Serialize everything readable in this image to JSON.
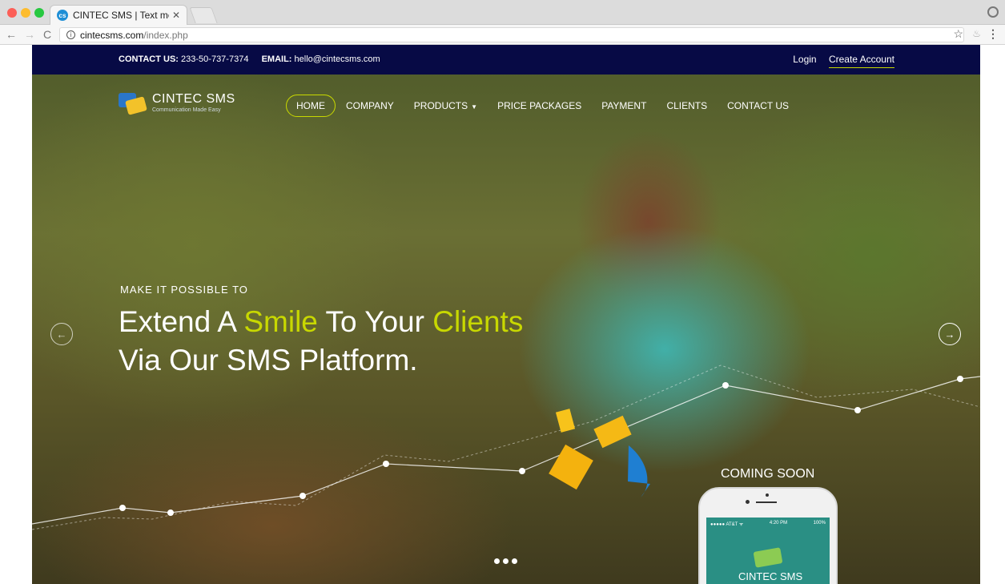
{
  "browser": {
    "tab_title": "CINTEC SMS | Text messaging",
    "favicon_text": "cs",
    "url_host": "cintecsms.com",
    "url_path": "/index.php"
  },
  "topbar": {
    "contact_label": "CONTACT US:",
    "contact_phone": "233-50-737-7374",
    "email_label": "EMAIL:",
    "email_value": "hello@cintecsms.com",
    "login": "Login",
    "create_account": "Create Account"
  },
  "logo": {
    "name": "CINTEC SMS",
    "tagline": "Communication Made Easy"
  },
  "nav": {
    "items": [
      {
        "label": "HOME"
      },
      {
        "label": "COMPANY"
      },
      {
        "label": "PRODUCTS"
      },
      {
        "label": "PRICE PACKAGES"
      },
      {
        "label": "PAYMENT"
      },
      {
        "label": "CLIENTS"
      },
      {
        "label": "CONTACT US"
      }
    ]
  },
  "hero": {
    "eyebrow": "MAKE IT POSSIBLE TO",
    "line1_a": "Extend A ",
    "line1_b": "Smile",
    "line1_c": " To Your ",
    "line1_d": "Clients",
    "line2": "Via Our SMS Platform."
  },
  "promo": {
    "coming_soon": "COMING SOON",
    "phone_carrier": "●●●●● AT&T ᯤ",
    "phone_time": "4:20 PM",
    "phone_battery": "100%",
    "phone_app_title": "CINTEC SMS"
  },
  "colors": {
    "topbar_bg": "#070a45",
    "accent": "#c8d800"
  }
}
